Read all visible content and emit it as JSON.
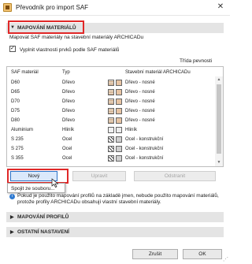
{
  "window": {
    "title": "Převodník pro import SAF",
    "close_glyph": "✕"
  },
  "section_mapping_materials": {
    "title": "MAPOVÁNÍ MATERIÁLŮ",
    "triangle": "▼"
  },
  "description": "Mapovat SAF materiály na stavební materiály ARCHICADu",
  "checkbox": {
    "label": "Vyplnit vlastnosti prvků podle SAF materiálů",
    "checked": true
  },
  "top_link": "Třída pevnosti",
  "table": {
    "headers": {
      "saf": "SAF materiál",
      "type": "Typ",
      "archicad": "Stavební materiál ARCHICADu"
    },
    "rows": [
      {
        "saf": "D60",
        "type": "Dřevo",
        "archicad": "Dřevo - nosné",
        "swatch": "wood"
      },
      {
        "saf": "D65",
        "type": "Dřevo",
        "archicad": "Dřevo - nosné",
        "swatch": "wood"
      },
      {
        "saf": "D70",
        "type": "Dřevo",
        "archicad": "Dřevo - nosné",
        "swatch": "wood"
      },
      {
        "saf": "D75",
        "type": "Dřevo",
        "archicad": "Dřevo - nosné",
        "swatch": "wood"
      },
      {
        "saf": "D80",
        "type": "Dřevo",
        "archicad": "Dřevo - nosné",
        "swatch": "wood"
      },
      {
        "saf": "Aluminium",
        "type": "Hliník",
        "archicad": "Hliník",
        "swatch": "metal"
      },
      {
        "saf": "S 235",
        "type": "Ocel",
        "archicad": "Ocel - konstrukční",
        "swatch": "hatch"
      },
      {
        "saf": "S 275",
        "type": "Ocel",
        "archicad": "Ocel - konstrukční",
        "swatch": "hatch"
      },
      {
        "saf": "S 355",
        "type": "Ocel",
        "archicad": "Ocel - konstrukční",
        "swatch": "hatch"
      }
    ]
  },
  "buttons": {
    "new": "Nový",
    "replace": "Upravit",
    "delete": "Odstranit"
  },
  "dropdown": {
    "item": "Spojit ze souboru..."
  },
  "info": {
    "icon": "i",
    "text": "Pokud je použito mapování profilů na základě jmen, nebude použito mapování materiálů, protože profily ARCHICADu obsahují vlastní stavební materiály."
  },
  "section_mapping_profiles": {
    "title": "MAPOVÁNÍ PROFILŮ",
    "triangle": "▶"
  },
  "section_other": {
    "title": "OSTATNÍ NASTAVENÍ",
    "triangle": "▶"
  },
  "footer": {
    "cancel": "Zrušit",
    "ok": "OK"
  },
  "colors": {
    "highlight_red": "#e02828",
    "section_bg": "#e4e4e4"
  }
}
